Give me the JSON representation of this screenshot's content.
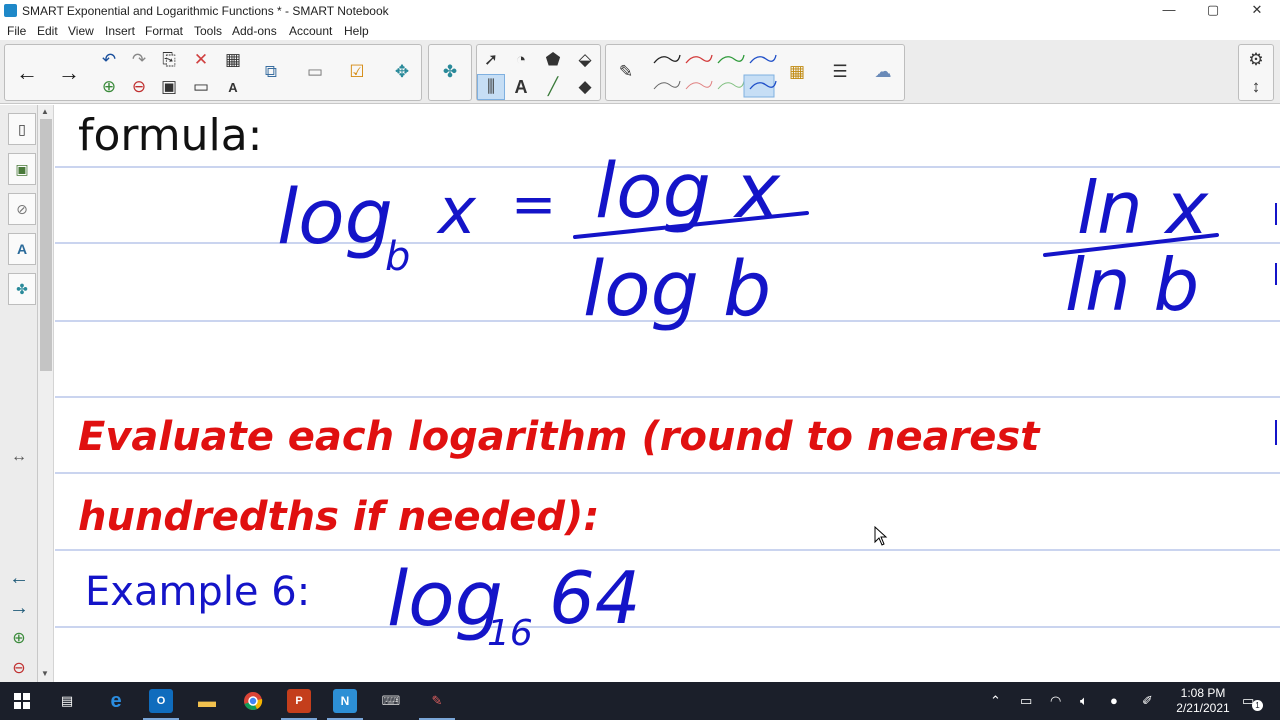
{
  "window": {
    "title": "SMART Exponential and Logarithmic Functions * - SMART Notebook",
    "minimize": "—",
    "maximize": "▢",
    "close": "✕"
  },
  "menu": [
    "File",
    "Edit",
    "View",
    "Insert",
    "Format",
    "Tools",
    "Add-ons",
    "Account",
    "Help"
  ],
  "toolbar": {
    "icons": [
      "back-arrow-icon",
      "forward-arrow-icon",
      "undo-icon",
      "redo-icon",
      "paste-icon",
      "delete-icon",
      "table-icon",
      "add-page-icon",
      "delete-page-icon",
      "save-icon",
      "fullscreen-icon",
      "text-tool-icon",
      "screen-capture-icon",
      "camera-icon",
      "response-icon",
      "add-on-icon",
      "puzzle-icon",
      "select-icon",
      "shapes-icon",
      "fill-icon",
      "pen-icon",
      "text-icon",
      "line-icon",
      "eraser-icon",
      "color-palette-icon",
      "line-properties-icon",
      "magic-pen-icon",
      "settings-icon",
      "toolbar-move-icon"
    ],
    "pen_colors": [
      "#222222",
      "#d23a3a",
      "#2e9a3a",
      "#1f4fc8"
    ]
  },
  "sidebar": {
    "icons": [
      "page-sorter-icon",
      "gallery-icon",
      "attachments-icon",
      "properties-icon",
      "add-ons-icon"
    ],
    "resize": "↔",
    "bottom_icons": [
      "previous-page-icon",
      "next-page-icon",
      "add-page-icon",
      "delete-page-icon"
    ]
  },
  "notebook": {
    "heading": "formula:",
    "formula_left": {
      "base_log": "log",
      "sub": "b",
      "var": "x",
      "eq": "=",
      "num": "log x",
      "den": "log b"
    },
    "formula_right": {
      "num": "ln x",
      "den": "ln b"
    },
    "instruction_line1": "Evaluate each logarithm (round to nearest",
    "instruction_line2": "hundredths if needed):",
    "example_label": "Example 6:",
    "example_expr": {
      "log": "log",
      "sub": "16",
      "arg": "64"
    },
    "colors": {
      "ink_blue": "#1414c8",
      "ink_red": "#e01010",
      "ink_black": "#111111",
      "rule_line": "#b9c6ea"
    }
  },
  "taskbar": {
    "apps": [
      "start-icon",
      "task-view-icon",
      "edge-icon",
      "outlook-icon",
      "file-explorer-icon",
      "chrome-icon",
      "powerpoint-icon",
      "smart-notebook-icon",
      "smart-tools-icon",
      "smart-ink-icon"
    ],
    "time": "1:08 PM",
    "date": "2/21/2021",
    "notification_count": "1"
  }
}
